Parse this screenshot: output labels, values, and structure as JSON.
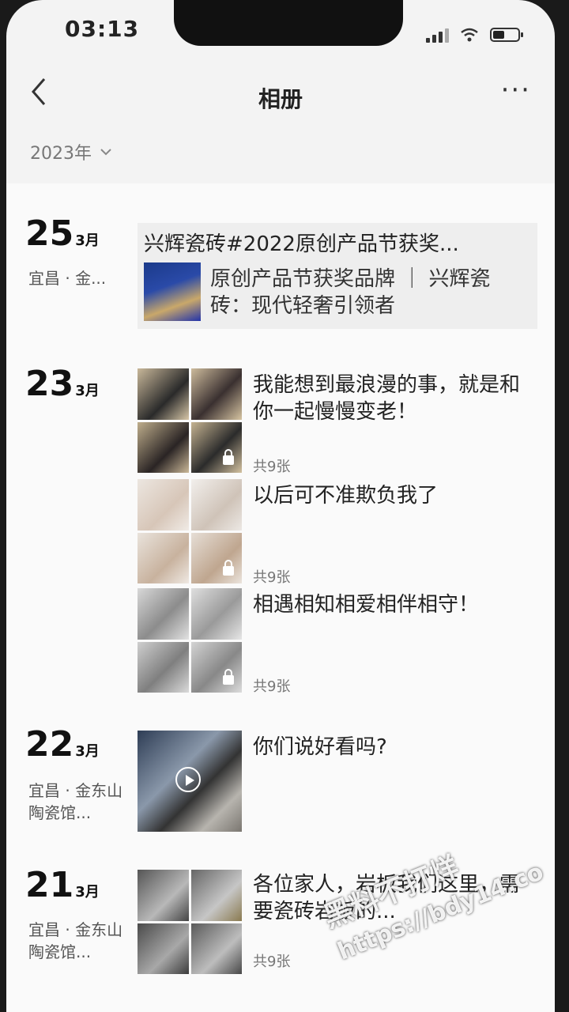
{
  "status": {
    "time": "03:13"
  },
  "nav": {
    "back_icon": "chevron-left-icon",
    "title": "相册",
    "more": "···"
  },
  "year_filter": {
    "label": "2023年",
    "icon": "chevron-down-icon"
  },
  "posts": {
    "d25": {
      "day": "25",
      "month": "3月",
      "location": "宜昌 · 金...",
      "link_title": "兴辉瓷砖#2022原创产品节获奖...",
      "link_desc": "原创产品节获奖品牌 ｜ 兴辉瓷砖：现代轻奢引领者"
    },
    "d23": {
      "day": "23",
      "month": "3月",
      "items": [
        {
          "text": "我能想到最浪漫的事，就是和你一起慢慢变老！",
          "count": "共9张"
        },
        {
          "text": "以后可不准欺负我了",
          "count": "共9张"
        },
        {
          "text": "相遇相知相爱相伴相守！",
          "count": "共9张"
        }
      ]
    },
    "d22": {
      "day": "22",
      "month": "3月",
      "location": "宜昌 · 金东山陶瓷馆...",
      "text": "你们说好看吗?"
    },
    "d21": {
      "day": "21",
      "month": "3月",
      "location": "宜昌 · 金东山陶瓷馆...",
      "text": "各位家人，岩板我们这里，需要瓷砖岩板的...",
      "count": "共9张"
    }
  },
  "watermark": {
    "line1": "黑料不打烊",
    "line2": "https://bdy14.co"
  }
}
